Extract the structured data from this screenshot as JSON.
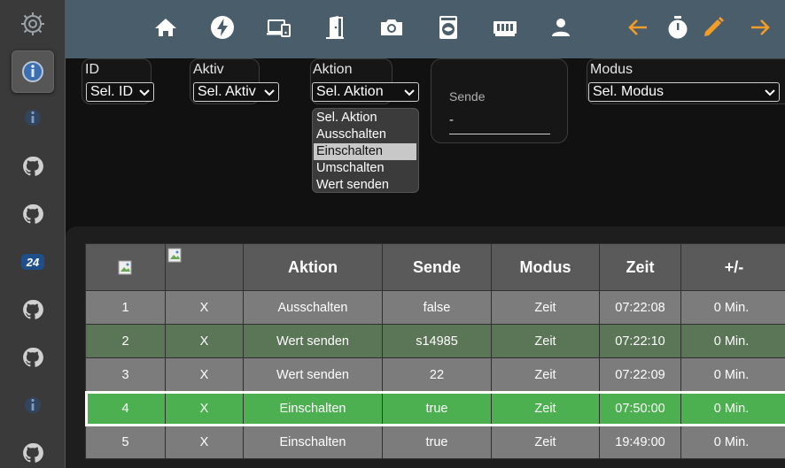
{
  "sidebar": {
    "items": [
      {
        "icon": "sun-gear-icon"
      },
      {
        "icon": "info-icon",
        "active": true
      },
      {
        "icon": "info-small-icon"
      },
      {
        "icon": "github-icon"
      },
      {
        "icon": "github-icon"
      },
      {
        "icon": "logo-24-icon",
        "text": "24"
      },
      {
        "icon": "github-icon"
      },
      {
        "icon": "github-icon"
      },
      {
        "icon": "info-small-icon"
      },
      {
        "icon": "github-icon"
      }
    ]
  },
  "toolbar": {
    "icons": [
      "home-icon",
      "flash-icon",
      "devices-icon",
      "door-icon",
      "camera-icon",
      "washing-machine-icon",
      "memory-icon",
      "account-icon",
      "arrow-left-icon",
      "timer-icon",
      "pencil-icon",
      "arrow-right-icon"
    ],
    "accent": "#f39c28"
  },
  "filters": {
    "id": {
      "label": "ID",
      "value": "Sel. ID"
    },
    "aktiv": {
      "label": "Aktiv",
      "value": "Sel. Aktiv"
    },
    "aktion": {
      "label": "Aktion",
      "value": "Sel. Aktion",
      "options": [
        "Sel. Aktion",
        "Ausschalten",
        "Einschalten",
        "Umschalten",
        "Wert senden"
      ],
      "highlighted": "Einschalten"
    },
    "sende": {
      "label": "Sende",
      "value": "-"
    },
    "modus": {
      "label": "Modus",
      "value": "Sel. Modus"
    }
  },
  "table": {
    "headers": [
      "",
      "",
      "Aktion",
      "Sende",
      "Modus",
      "Zeit",
      "+/-"
    ],
    "rows": [
      {
        "id": "1",
        "aktiv": "X",
        "aktion": "Ausschalten",
        "sende": "false",
        "modus": "Zeit",
        "zeit": "07:22:08",
        "offset": "0 Min.",
        "style": "gray"
      },
      {
        "id": "2",
        "aktiv": "X",
        "aktion": "Wert senden",
        "sende": "s14985",
        "modus": "Zeit",
        "zeit": "07:22:10",
        "offset": "0 Min.",
        "style": "dgreen"
      },
      {
        "id": "3",
        "aktiv": "X",
        "aktion": "Wert senden",
        "sende": "22",
        "modus": "Zeit",
        "zeit": "07:22:09",
        "offset": "0 Min.",
        "style": "gray"
      },
      {
        "id": "4",
        "aktiv": "X",
        "aktion": "Einschalten",
        "sende": "true",
        "modus": "Zeit",
        "zeit": "07:50:00",
        "offset": "0 Min.",
        "style": "green"
      },
      {
        "id": "5",
        "aktiv": "X",
        "aktion": "Einschalten",
        "sende": "true",
        "modus": "Zeit",
        "zeit": "19:49:00",
        "offset": "0 Min.",
        "style": "gray"
      }
    ]
  }
}
